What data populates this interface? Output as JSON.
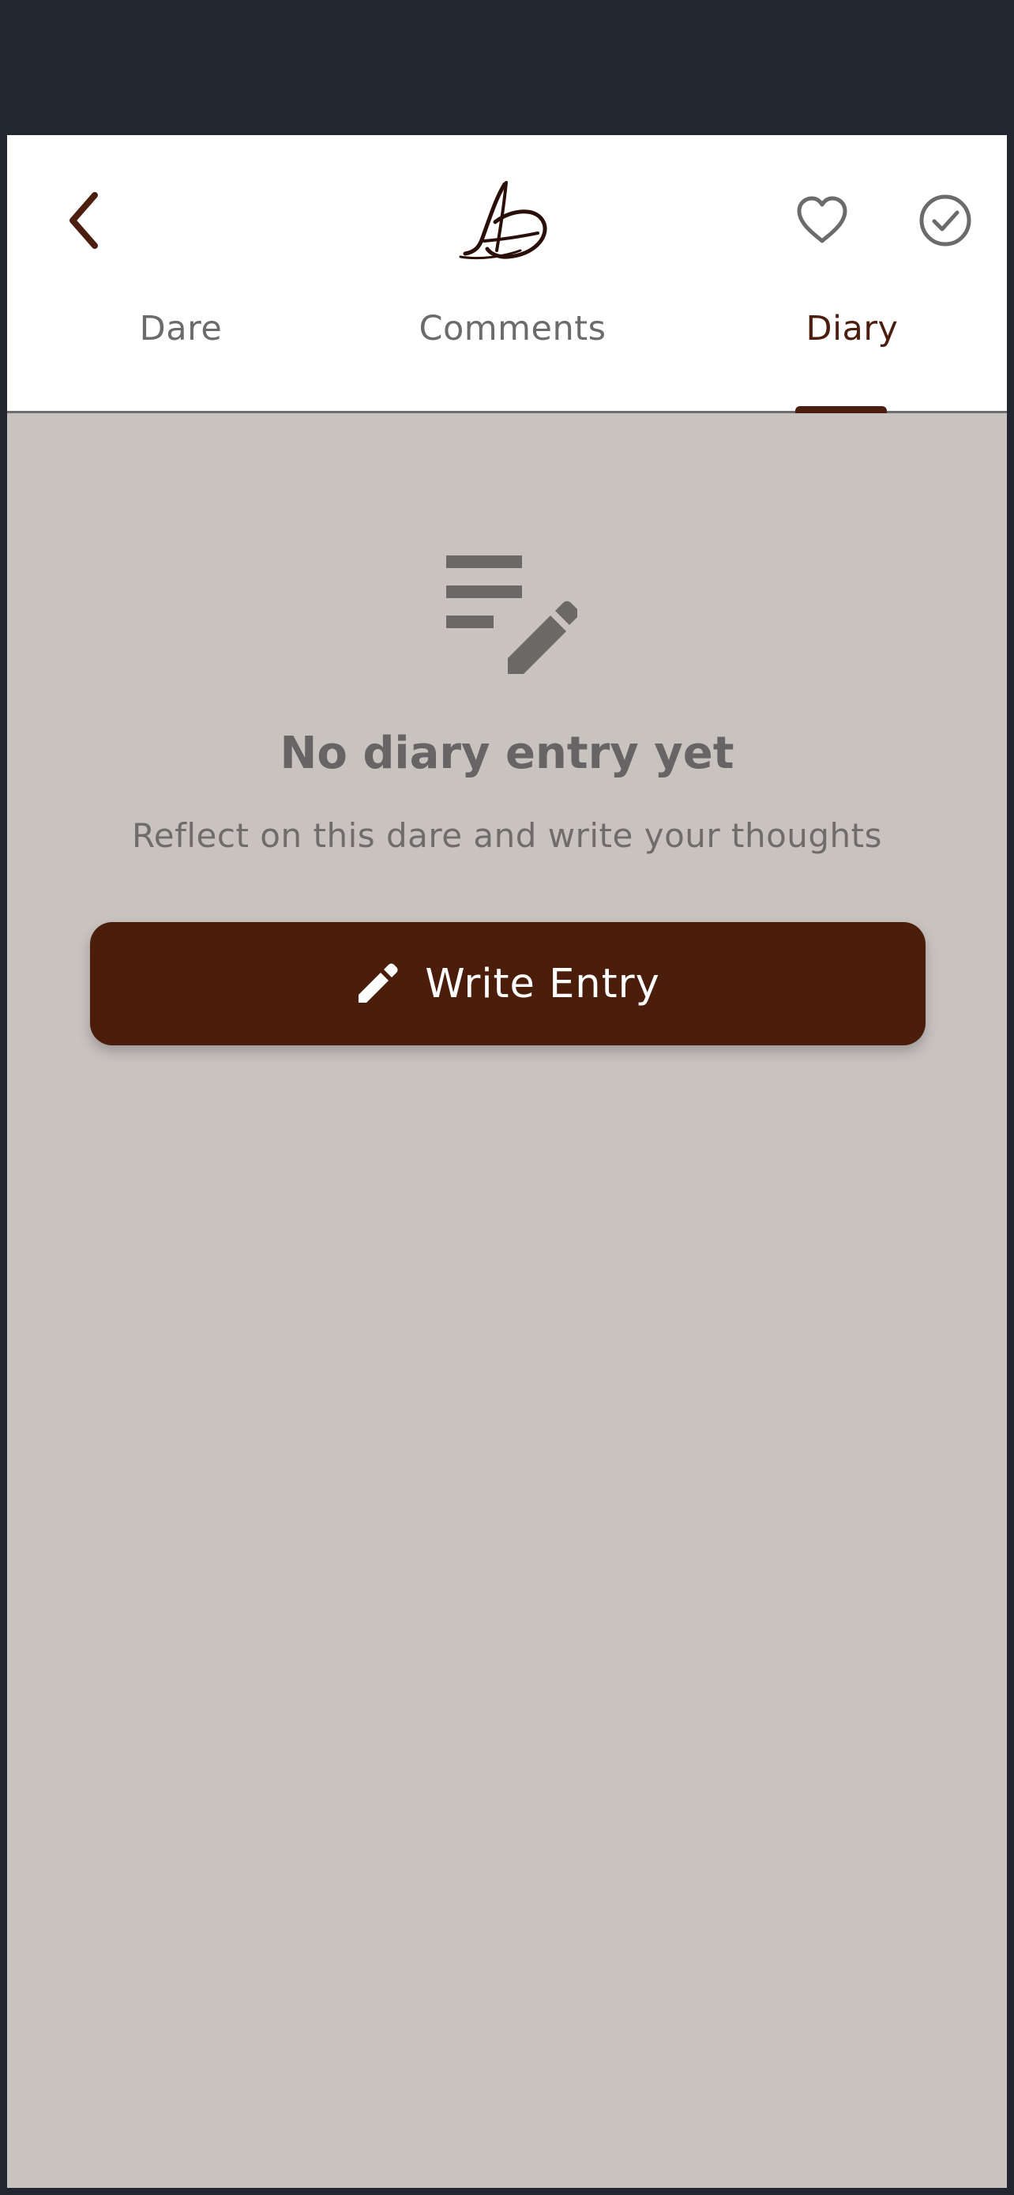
{
  "app": {
    "logo": "LD",
    "icons": {
      "back": "chevron-left-icon",
      "favorite": "heart-icon",
      "complete": "check-circle-icon",
      "empty": "notes-edit-icon",
      "write": "pencil-icon"
    },
    "colors": {
      "accent": "#4b1e0c",
      "background": "#c9c3c0",
      "header": "#ffffff",
      "statusbar": "#222630"
    }
  },
  "tabs": [
    {
      "label": "Dare",
      "active": false
    },
    {
      "label": "Comments",
      "active": false
    },
    {
      "label": "Diary",
      "active": true
    }
  ],
  "empty_state": {
    "title": "No diary entry yet",
    "subtitle": "Reflect on this dare and write your thoughts",
    "button_label": "Write Entry"
  }
}
